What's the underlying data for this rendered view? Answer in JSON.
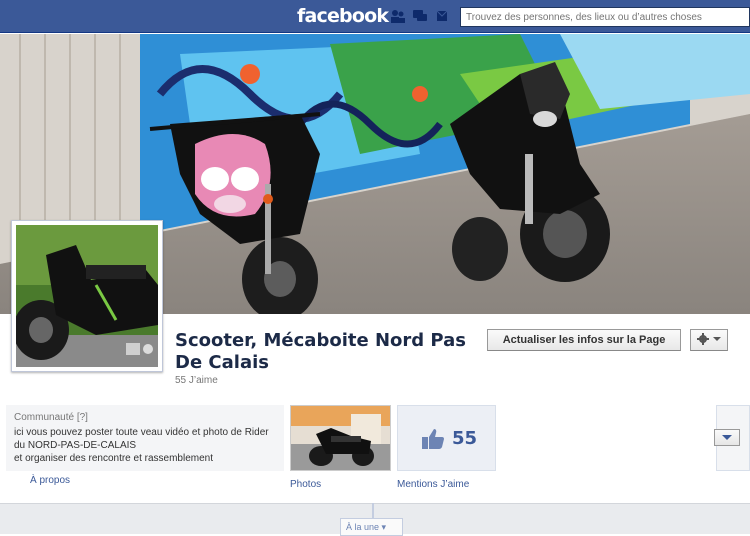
{
  "header": {
    "logo": "facebook",
    "search_placeholder": "Trouvez des personnes, des lieux ou d’autres choses",
    "brand_color": "#3b5998",
    "icons": [
      "friends-icon",
      "messages-icon",
      "notifications-icon"
    ]
  },
  "page": {
    "name": "Scooter, Mécaboite Nord Pas De Calais",
    "likes_line": "55 J’aime",
    "update_button": "Actualiser les infos sur la Page",
    "settings_icon": "gear-icon"
  },
  "about": {
    "category": "Communauté",
    "help_marker": "[?]",
    "line1": "ici vous pouvez poster toute veau vidéo et photo de Rider",
    "line2": "du NORD-PAS-DE-CALAIS",
    "line3": "et organiser des rencontre et rassemblement",
    "link": "À propos"
  },
  "apps": {
    "photos_label": "Photos",
    "likes_count": "55",
    "likes_label": "Mentions J’aime"
  },
  "timeline": {
    "scrubber": "À la une ▾"
  }
}
